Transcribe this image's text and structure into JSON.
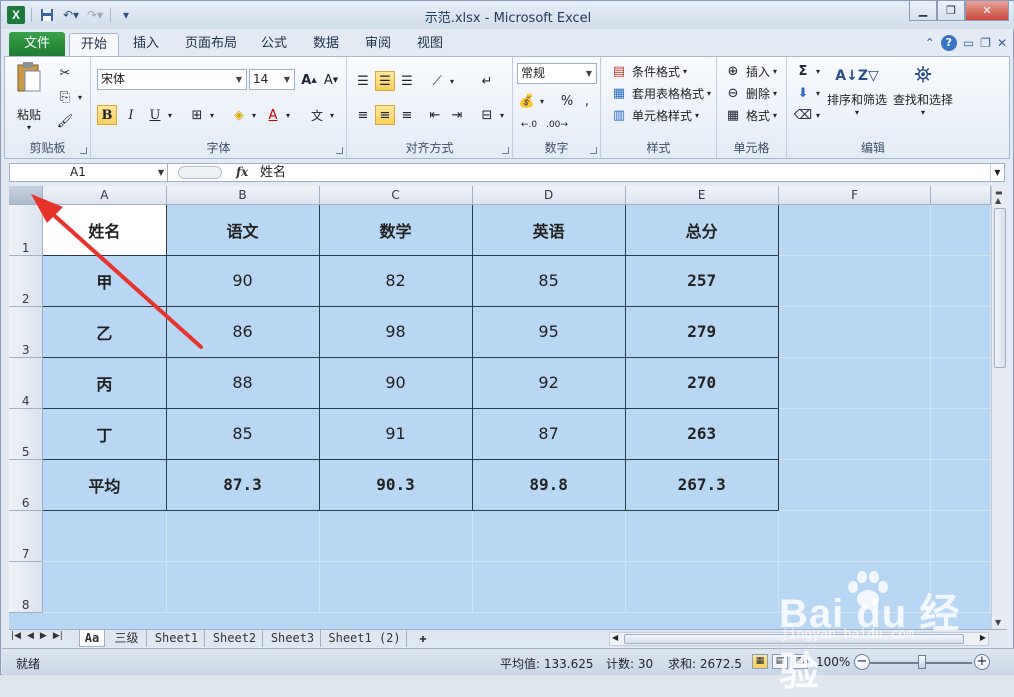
{
  "window": {
    "title": "示范.xlsx - Microsoft Excel"
  },
  "qat": {
    "app_icon": "X"
  },
  "tabs": [
    {
      "label": "文件"
    },
    {
      "label": "开始"
    },
    {
      "label": "插入"
    },
    {
      "label": "页面布局"
    },
    {
      "label": "公式"
    },
    {
      "label": "数据"
    },
    {
      "label": "审阅"
    },
    {
      "label": "视图"
    }
  ],
  "ribbon": {
    "clipboard": {
      "label": "剪贴板",
      "paste": "粘贴"
    },
    "font": {
      "label": "字体",
      "name": "宋体",
      "size": "14",
      "bold": "B",
      "italic": "I",
      "underline": "U"
    },
    "alignment": {
      "label": "对齐方式"
    },
    "number": {
      "label": "数字",
      "format": "常规",
      "percent": "%",
      "comma": ","
    },
    "styles": {
      "label": "样式",
      "conditional": "条件格式",
      "table": "套用表格格式",
      "cell": "单元格样式"
    },
    "cells": {
      "label": "单元格",
      "insert": "插入",
      "delete": "删除",
      "format": "格式"
    },
    "editing": {
      "label": "编辑",
      "sort": "排序和筛选",
      "find": "查找和选择",
      "sum": "Σ"
    }
  },
  "formula_bar": {
    "name_box": "A1",
    "fx": "fx",
    "content": "姓名"
  },
  "columns": [
    "A",
    "B",
    "C",
    "D",
    "E",
    "F"
  ],
  "rows": [
    "1",
    "2",
    "3",
    "4",
    "5",
    "6",
    "7",
    "8"
  ],
  "table": [
    [
      "姓名",
      "语文",
      "数学",
      "英语",
      "总分"
    ],
    [
      "甲",
      "90",
      "82",
      "85",
      "257"
    ],
    [
      "乙",
      "86",
      "98",
      "95",
      "279"
    ],
    [
      "丙",
      "88",
      "90",
      "92",
      "270"
    ],
    [
      "丁",
      "85",
      "91",
      "87",
      "263"
    ],
    [
      "平均",
      "87.3",
      "90.3",
      "89.8",
      "267.3"
    ]
  ],
  "sheets": [
    "Aa",
    "三级",
    "Sheet1",
    "Sheet2",
    "Sheet3",
    "Sheet1 (2)"
  ],
  "status": {
    "ready": "就绪",
    "average": "平均值: 133.625",
    "count": "计数: 30",
    "sum": "求和: 2672.5",
    "zoom": "100%"
  },
  "watermark": {
    "brand": "Bai du 经验",
    "url": "jingyan.baidu.com"
  },
  "colors": {
    "selection": "#b8d7f5",
    "file_tab": "#1f7c31",
    "arrow": "#e8332a"
  }
}
